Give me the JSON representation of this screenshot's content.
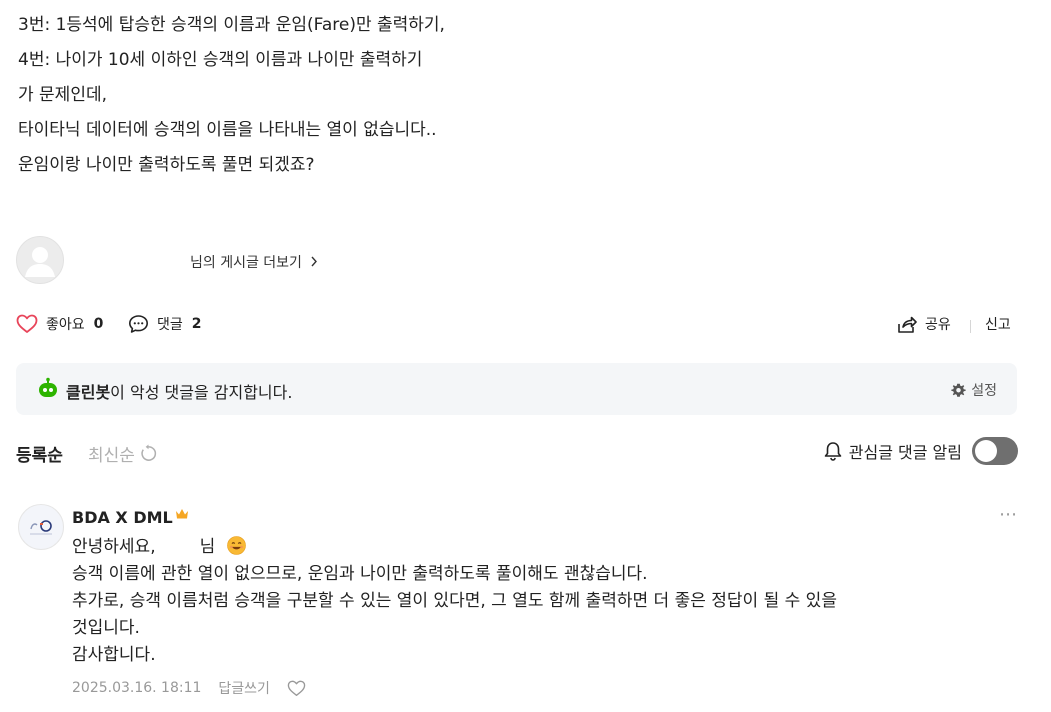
{
  "post": {
    "lines": [
      "3번: 1등석에 탑승한 승객의 이름과 운임(Fare)만 출력하기,",
      "4번: 나이가 10세 이하인 승객의 이름과 나이만 출력하기",
      "가 문제인데,",
      "타이타닉 데이터에 승객의 이름을 나타내는 열이 없습니다..",
      "운임이랑 나이만 출력하도록 풀면 되겠죠?"
    ]
  },
  "author_row": {
    "more_posts_label": "님의 게시글 더보기"
  },
  "actions": {
    "like_label": "좋아요",
    "like_count": "0",
    "comment_label": "댓글",
    "comment_count": "2",
    "share_label": "공유",
    "report_label": "신고"
  },
  "cleanbot": {
    "name": "클린봇",
    "message": "이 악성 댓글을 감지합니다.",
    "settings_label": "설정"
  },
  "comments_header": {
    "sort_registered": "등록순",
    "sort_latest": "최신순",
    "notify_label": "관심글 댓글 알림",
    "notify_on": false
  },
  "comments": [
    {
      "author": "BDA X DML",
      "greeting": "안녕하세요,",
      "greeting_suffix": "님",
      "lines": [
        "승객 이름에 관한 열이 없으므로, 운임과 나이만 출력하도록 풀이해도 괜찮습니다.",
        "추가로, 승객 이름처럼 승객을 구분할 수 있는 열이 있다면, 그 열도 함께 출력하면 더 좋은 정답이 될 수 있을",
        "것입니다.",
        "감사합니다."
      ],
      "date": "2025.03.16. 18:11",
      "reply_label": "답글쓰기"
    }
  ],
  "colors": {
    "like_heart": "#e8455a",
    "cleanbot_green": "#2db400",
    "bot_box_bg": "#f4f6f8",
    "crown": "#f5a623",
    "toggle_off": "#6f6f6f"
  },
  "icons": [
    "heart-icon",
    "comment-icon",
    "share-icon",
    "cleanbot-icon",
    "gear-icon",
    "refresh-icon",
    "bell-icon",
    "crown-icon",
    "smile-emoji-icon",
    "more-icon"
  ]
}
